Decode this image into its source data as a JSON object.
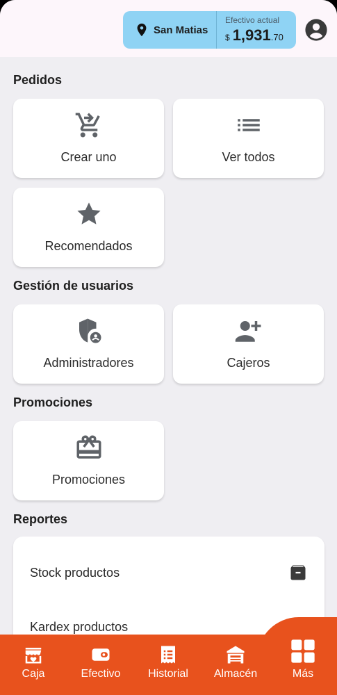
{
  "header": {
    "location": "San Matias",
    "cash_label": "Efectivo actual",
    "cash_symbol": "$",
    "cash_integer": "1,931",
    "cash_decimal": ".70"
  },
  "sections": {
    "pedidos": {
      "title": "Pedidos",
      "create": "Crear uno",
      "view_all": "Ver todos",
      "recommended": "Recomendados"
    },
    "usuarios": {
      "title": "Gestión de usuarios",
      "admins": "Administradores",
      "cashiers": "Cajeros"
    },
    "promociones": {
      "title": "Promociones",
      "promos": "Promociones"
    },
    "reportes": {
      "title": "Reportes",
      "items": [
        "Stock productos",
        "Kardex productos"
      ]
    }
  },
  "bottom_nav": {
    "items": [
      "Caja",
      "Efectivo",
      "Historial",
      "Almacén",
      "Más"
    ]
  },
  "colors": {
    "accent": "#e8521d",
    "header_chip": "#8fd3f4",
    "icon": "#5f6368"
  }
}
